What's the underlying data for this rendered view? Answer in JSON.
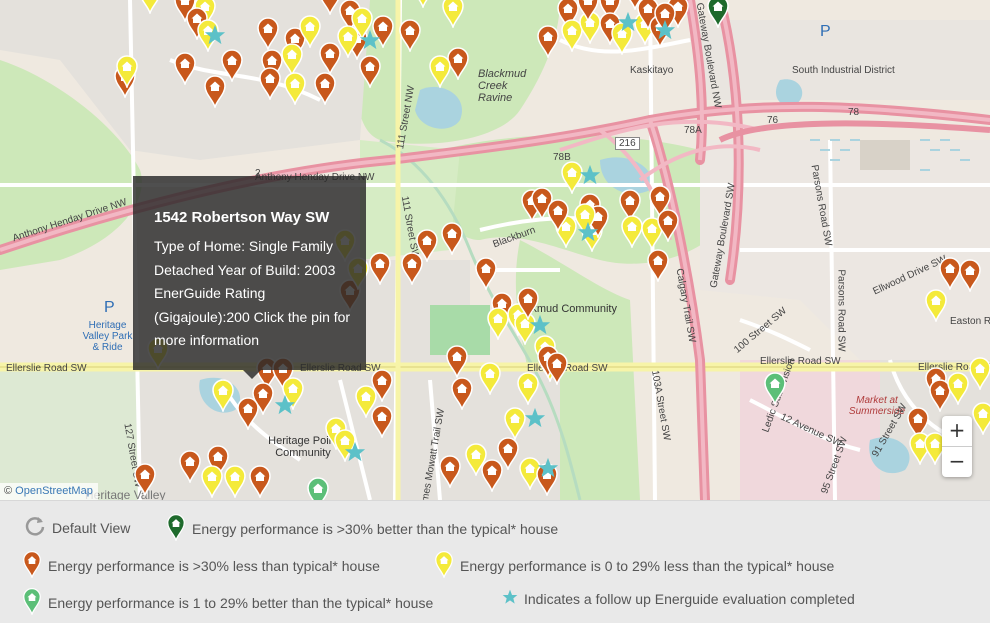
{
  "tooltip": {
    "address": "1542 Robertson Way SW",
    "body": "Type of Home: Single Family Detached Year of Build: 2003 EnerGuide Rating (Gigajoule):200 Click the pin for more information"
  },
  "map_labels": {
    "anthony_henday_1": "Anthony Henday Drive NW",
    "anthony_henday_2": "Anthony Henday Drive NW",
    "street_111": "111 Street NW",
    "street_111_sw": "111 Street SW",
    "blackmud_creek_ravine": "Blackmud Creek Ravine",
    "south_industrial": "South Industrial District",
    "kaskitayo": "Kaskitayo",
    "gateway_blvd_nw": "Gateway Boulevard NW",
    "gateway_blvd_sw": "Gateway Boulevard SW",
    "calgary_trail": "Calgary Trail SW",
    "parsons_rd": "Parsons Road SW",
    "parsons_rd_2": "Parsons Road SW",
    "route_216": "216",
    "route_2": "2",
    "route_78": "78",
    "route_78a": "78A",
    "route_78b": "78B",
    "route_76": "76",
    "blackmud_community": "Blackmud Community",
    "blackburn": "Blackburn",
    "ellerslie_left": "Ellerslie Road SW",
    "ellerslie_mid": "Ellerslie Road SW",
    "ellerslie_mid2": "Ellerslie Road SW",
    "ellerslie_right": "Ellerslie Road SW",
    "heritage_valley_park": "Heritage Valley Park & Ride",
    "heritage_point": "Heritage Point Community",
    "ellwood": "Ellwood Drive SW",
    "easton": "Easton R",
    "market_summerside": "Market at Summerside",
    "st_100": "100 Street SW",
    "st_103a": "103A Street SW",
    "st_12_ave": "12 Avenue SW",
    "st_95": "95 Street SW",
    "st_91": "91 Street SW",
    "st_127": "127 Street SW",
    "james_mowatt": "James Mowatt Trail SW",
    "ledic": "Ledic Subdivision",
    "heritage_valley": "Heritage Valley",
    "trail_sw_2": "Calgary Trail SW",
    "parking": "P"
  },
  "attribution": {
    "prefix": "©",
    "link": "OpenStreetMap"
  },
  "zoom": {
    "plus": "+",
    "minus": "−"
  },
  "legend": {
    "default_view": "Default View",
    "dark_green": "Energy performance is >30% better than the typical* house",
    "orange": "Energy performance is >30% less than typical* house",
    "yellow": "Energy performance is 0 to 29% less than the typical* house",
    "light_green": "Energy performance is 1 to 29% better than the typical* house",
    "star": "Indicates a follow up Energuide evaluation completed"
  },
  "colors": {
    "orange": "#c8581c",
    "yellow": "#f4ea3a",
    "light_green": "#5cbf78",
    "dark_green": "#1e6a2c",
    "star": "#5cc1c8"
  }
}
